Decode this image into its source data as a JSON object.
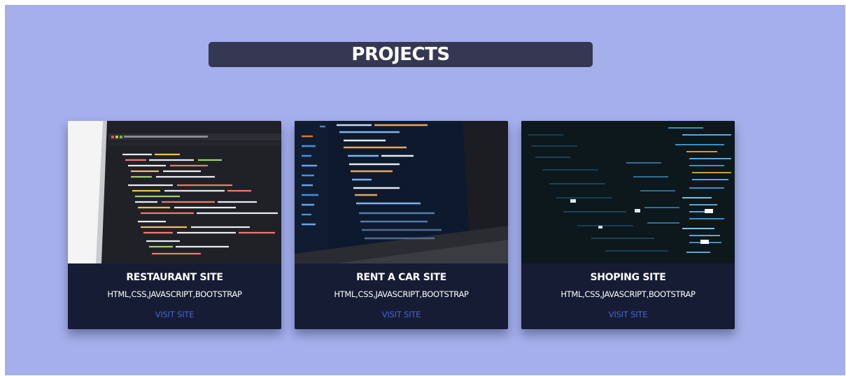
{
  "page": {
    "title": "PROJECTS",
    "background_color": "#a4afec",
    "title_bar_color": "#343852"
  },
  "projects": [
    {
      "name": "RESTAURANT SITE",
      "technologies": "HTML,CSS,JAVASCRIPT,BOOTSTRAP",
      "link_label": "VISIT SITE",
      "image": "laptop-code-editor-image"
    },
    {
      "name": "RENT A CAR SITE",
      "technologies": "HTML,CSS,JAVASCRIPT,BOOTSTRAP",
      "link_label": "VISIT SITE",
      "image": "dark-laptop-code-image"
    },
    {
      "name": "SHOPING SITE",
      "technologies": "HTML,CSS,JAVASCRIPT,BOOTSTRAP",
      "link_label": "VISIT SITE",
      "image": "dark-code-screen-image"
    }
  ],
  "colors": {
    "card_background": "#161c33",
    "link_color": "#4a63d6",
    "text_color": "#ffffff"
  }
}
